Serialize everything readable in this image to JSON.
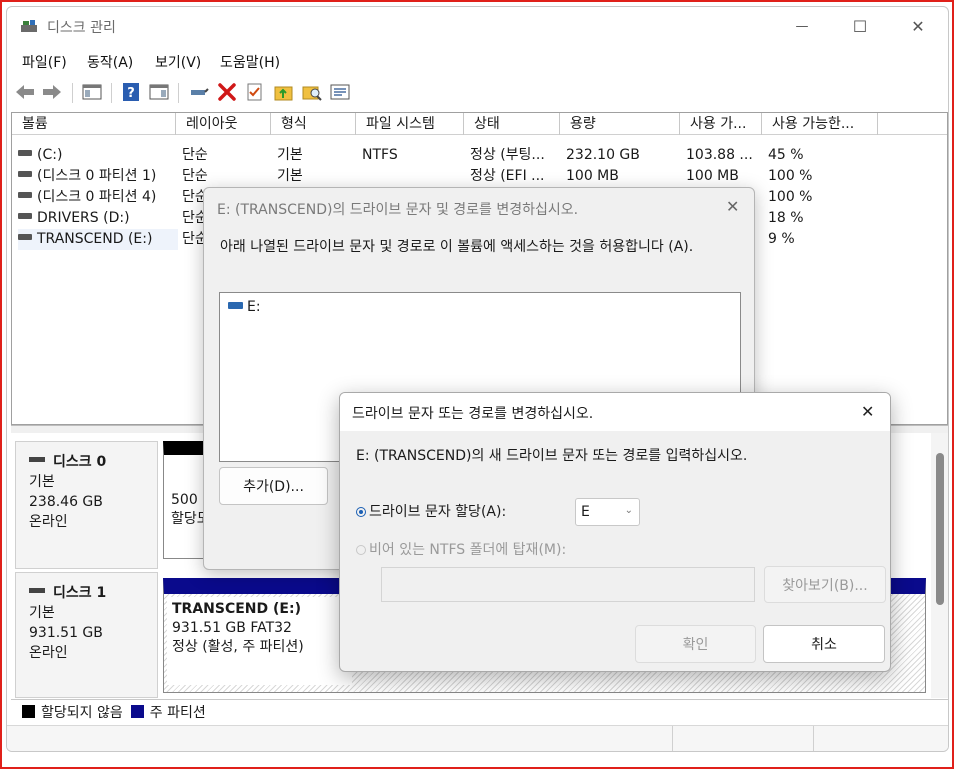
{
  "window": {
    "title": "디스크 관리",
    "controls": {
      "minimize": "—",
      "maximize": "☐",
      "close": "✕"
    }
  },
  "menu": [
    "파일(F)",
    "동작(A)",
    "보기(V)",
    "도움말(H)"
  ],
  "toolbar_icons": [
    "back-arrow-icon",
    "forward-arrow-icon",
    "console-tree-icon",
    "help-icon",
    "properties-pane-icon",
    "connect-icon",
    "delete-icon",
    "check-icon",
    "folder-up-icon",
    "search-folder-icon",
    "list-view-icon"
  ],
  "table": {
    "columns": [
      "볼륨",
      "레이아웃",
      "형식",
      "파일 시스템",
      "상태",
      "용량",
      "사용 가...",
      "사용 가능한..."
    ],
    "rows": [
      [
        "(C:)",
        "단순",
        "기본",
        "NTFS",
        "정상 (부팅...",
        "232.10 GB",
        "103.88 ...",
        "45 %"
      ],
      [
        "(디스크 0 파티션 1)",
        "단순",
        "기본",
        "",
        "정상 (EFI ...",
        "100 MB",
        "100 MB",
        "100 %"
      ],
      [
        "(디스크 0 파티션 4)",
        "단순",
        "",
        "",
        "",
        "",
        "",
        "100 %"
      ],
      [
        "DRIVERS (D:)",
        "단순",
        "",
        "",
        "",
        "",
        "",
        "18 %"
      ],
      [
        "TRANSCEND (E:)",
        "단순",
        "",
        "",
        "",
        "",
        "",
        "9 %"
      ]
    ]
  },
  "disks": [
    {
      "name": "디스크 0",
      "type": "기본",
      "size": "238.46 GB",
      "status": "온라인",
      "part_line1": "500 M",
      "part_line2": "할당도"
    },
    {
      "name": "디스크 1",
      "type": "기본",
      "size": "931.51 GB",
      "status": "온라인",
      "part_name": "TRANSCEND  (E:)",
      "part_size": "931.51 GB FAT32",
      "part_status": "정상 (활성, 주 파티션)"
    }
  ],
  "legend": {
    "unallocated": "할당되지 않음",
    "primary": "주 파티션",
    "unallocated_color": "#000000",
    "primary_color": "#0a0a8c"
  },
  "dialog1": {
    "title": "E: (TRANSCEND)의 드라이브 문자 및 경로를 변경하십시오.",
    "description": "아래 나열된 드라이브 문자 및 경로로 이 볼륨에 액세스하는 것을 허용합니다 (A).",
    "list_items": [
      "E:"
    ],
    "add_button": "추가(D)..."
  },
  "dialog2": {
    "title": "드라이브 문자 또는 경로를 변경하십시오.",
    "prompt": "E: (TRANSCEND)의 새 드라이브 문자 또는 경로를 입력하십시오.",
    "option_letter": "드라이브 문자 할당(A):",
    "option_folder": "비어 있는 NTFS 폴더에 탑재(M):",
    "letter_value": "E",
    "browse_button": "찾아보기(B)...",
    "ok_button": "확인",
    "cancel_button": "취소"
  },
  "colors": {
    "accent": "#1a5fb4",
    "border_highlight": "#e0201a"
  }
}
